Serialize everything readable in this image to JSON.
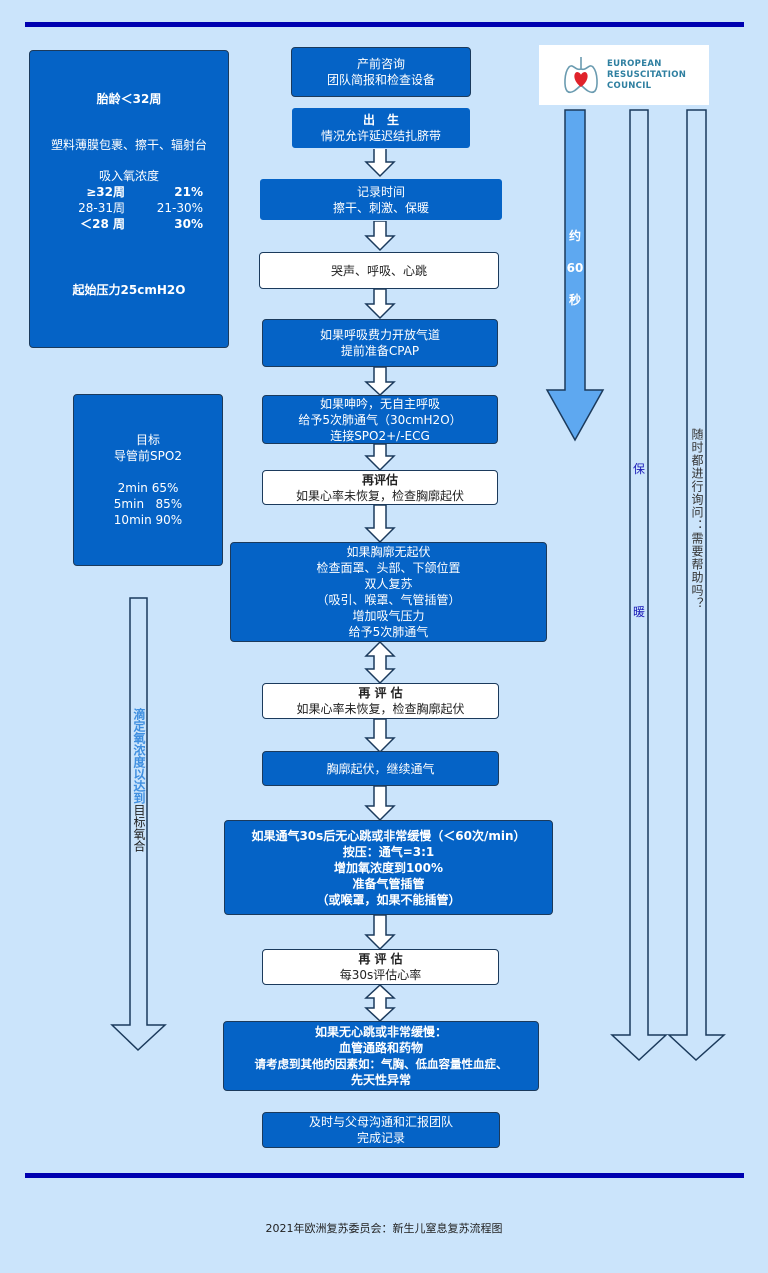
{
  "footer": "2021年欧洲复苏委员会：新生儿窒息复苏流程图",
  "logo": {
    "lines": [
      "EUROPEAN",
      "RESUSCITATION",
      "COUNCIL"
    ],
    "icon": "lungs-heart-icon"
  },
  "left_panel_1": {
    "title": "胎龄＜32周",
    "care": "塑料薄膜包裹、擦干、辐射台",
    "oxygen_title": "吸入氧浓度",
    "oxygen_rows": [
      {
        "age": "≥32周",
        "value": "21%"
      },
      {
        "age": "28-31周",
        "value": "21-30%"
      },
      {
        "age": "＜28 周",
        "value": "30%"
      }
    ],
    "pressure": "起始压力25cmH2O"
  },
  "left_panel_2": {
    "title": "目标",
    "subtitle": "导管前SPO2",
    "targets": [
      "2min 65%",
      "5min   85%",
      "10min 90%"
    ]
  },
  "flow": [
    {
      "id": "antenatal",
      "style": "blue",
      "lines": [
        "产前咨询",
        "团队简报和检查设备"
      ]
    },
    {
      "id": "birth",
      "style": "blue",
      "lines": [
        "出　生",
        "情况允许延迟结扎脐带"
      ]
    },
    {
      "id": "record-time",
      "style": "blue",
      "lines": [
        "记录时间",
        "擦干、刺激、保暖"
      ]
    },
    {
      "id": "assess",
      "style": "white",
      "lines": [
        "哭声、呼吸、心跳"
      ]
    },
    {
      "id": "open-airway",
      "style": "blue",
      "lines": [
        "如果呼吸费力开放气道",
        "提前准备CPAP"
      ]
    },
    {
      "id": "inflation",
      "style": "blue",
      "lines": [
        "如果呻吟，无自主呼吸",
        "给予5次肺通气（30cmH2O）",
        "连接SPO2+/-ECG"
      ]
    },
    {
      "id": "reassess-1",
      "style": "white",
      "lines": [
        "再评估",
        "如果心率未恢复，检查胸廓起伏"
      ]
    },
    {
      "id": "no-chest-rise",
      "style": "blue",
      "lines": [
        "如果胸廓无起伏",
        "检查面罩、头部、下颌位置",
        "双人复苏",
        "（吸引、喉罩、气管插管）",
        "增加吸气压力",
        "给予5次肺通气"
      ]
    },
    {
      "id": "reassess-2",
      "style": "white",
      "lines": [
        "再 评 估",
        "如果心率未恢复，检查胸廓起伏"
      ]
    },
    {
      "id": "chest-rise",
      "style": "blue",
      "lines": [
        "胸廓起伏，继续通气"
      ]
    },
    {
      "id": "compressions",
      "style": "blue",
      "lines": [
        "如果通气30s后无心跳或非常缓慢（＜60次/min）",
        "按压：通气=3:1",
        "增加氧浓度到100%",
        "准备气管插管",
        "（或喉罩，如果不能插管）"
      ]
    },
    {
      "id": "reassess-3",
      "style": "white",
      "lines": [
        "再 评 估",
        "每30s评估心率"
      ]
    },
    {
      "id": "drugs",
      "style": "blue",
      "lines": [
        "如果无心跳或非常缓慢：",
        "血管通路和药物",
        "请考虑到其他的因素如：气胸、低血容量性血症、",
        "先天性异常"
      ]
    },
    {
      "id": "communicate",
      "style": "blue",
      "lines": [
        "及时与父母沟通和汇报团队",
        "完成记录"
      ]
    }
  ],
  "side_arrows": {
    "sixty_seconds": [
      "约",
      "60",
      "秒"
    ],
    "keep_warm": [
      "保",
      "暖"
    ],
    "ask_help": "随时都进行询问：需要帮助吗？",
    "titrate_blue": "滴定氧浓度以达到",
    "titrate_black": "目标氧合"
  },
  "colors": {
    "background": "#cbe4fb",
    "rule": "#0000b0",
    "box_blue": "#0563c6",
    "arrow_blue": "#5ea8f0",
    "text_accent": "#1a1ab8"
  }
}
